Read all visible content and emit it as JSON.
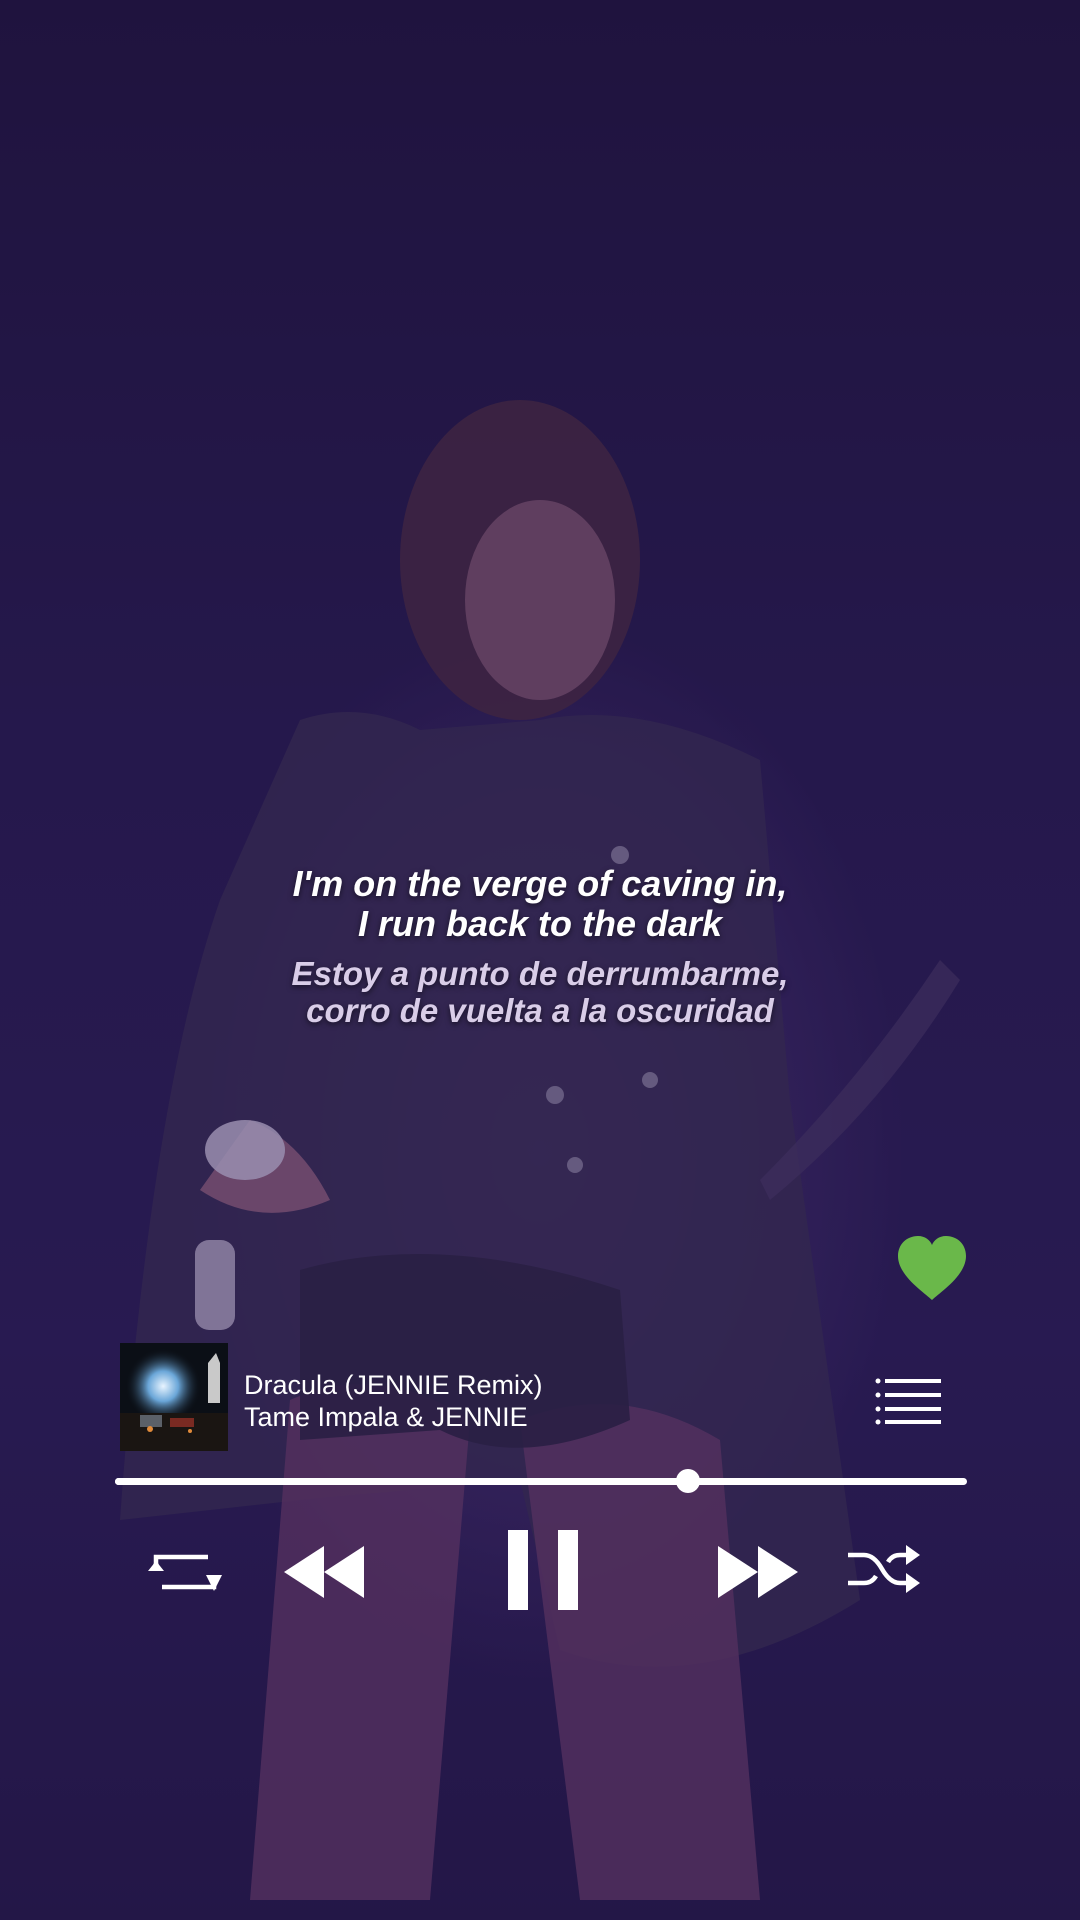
{
  "lyrics": {
    "original": [
      "I'm on the verge of caving in,",
      "I run back to the dark"
    ],
    "translation": [
      "Estoy a punto de derrumbarme,",
      "corro de vuelta a la oscuridad"
    ]
  },
  "player": {
    "track_title": "Dracula (JENNIE Remix)",
    "artist": "Tame Impala & JENNIE",
    "liked": true,
    "progress_fraction": 0.672,
    "is_playing": true
  },
  "icons": {
    "like": "heart-icon",
    "queue": "queue-list-icon",
    "repeat": "repeat-icon",
    "previous": "rewind-icon",
    "play_pause": "pause-icon",
    "next": "fast-forward-icon",
    "shuffle": "shuffle-icon"
  },
  "colors": {
    "accent_like": "#6ab84a",
    "controls": "#ffffff",
    "background": "#261a4e"
  }
}
